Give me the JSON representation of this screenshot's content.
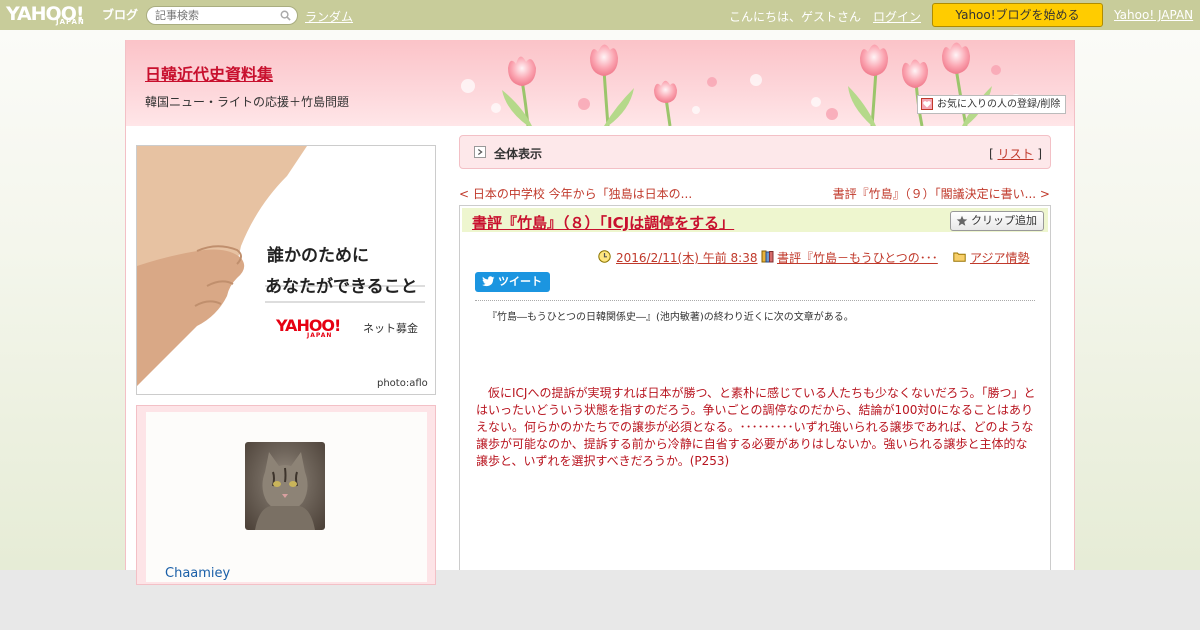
{
  "topbar": {
    "logo_yahoo": "YAHOO!",
    "logo_japan": "JAPAN",
    "logo_blog": "ブログ",
    "search_placeholder": "記事検索",
    "random_label": "ランダム",
    "greeting": "こんにちは、ゲストさん",
    "login_label": "ログイン",
    "start_button": "Yahoo!ブログを始める",
    "yahoo_japan_link": "Yahoo! JAPAN"
  },
  "header": {
    "blog_title": "日韓近代史資料集",
    "blog_subtitle": "韓国ニュー・ライトの応援＋竹島問題",
    "favorite_button": "お気に入りの人の登録/削除"
  },
  "sidebar": {
    "ad": {
      "line1": "誰かのために",
      "line2": "あなたができること",
      "logo": "YAHOO!",
      "logo_japan": "JAPAN",
      "service": "ネット募金",
      "credit": "photo:aflo"
    },
    "profile": {
      "username": "Chaamiey"
    }
  },
  "content": {
    "allview_label": "全体表示",
    "list_open": "[ ",
    "list_label": "リスト",
    "list_close": " ]",
    "prev_link": "< 日本の中学校 今年から「独島は日本の...",
    "next_link": "書評『竹島』（９）「閣議決定に書い... >",
    "article": {
      "title": "書評『竹島』（８）「ICJは調停をする」",
      "clip_button": "クリップ追加",
      "date": "2016/2/11(木) 午前 8:38",
      "theme": "書評『竹島－もうひとつの･･･",
      "category": "アジア情勢",
      "tweet_label": "ツイート",
      "intro": "『竹島―もうひとつの日韓関係史―』(池内敏著)の終わり近くに次の文章がある。",
      "quote": "　仮にICJへの提訴が実現すれば日本が勝つ、と素朴に感じている人たちも少なくないだろう。「勝つ」とはいったいどういう状態を指すのだろう。争いごとの調停なのだから、結論が100対0になることはありえない。何らかのかたちでの譲歩が必須となる。･････････いずれ強いられる譲歩であれば、どのような譲歩が可能なのか、提訴する前から冷静に自省する必要がありはしないか。強いられる譲歩と主体的な譲歩と、いずれを選択すべきだろうか。(P253)"
    }
  },
  "colors": {
    "topbar": "#c8cc9a",
    "accent": "#c8102e",
    "start_button": "#ffcc00",
    "header_pink": "#fbc3c8",
    "title_bar": "#eef6cf",
    "tweet": "#1b95e0"
  },
  "icons": [
    "search-icon",
    "favorite-icon",
    "clock-icon",
    "book-icon",
    "folder-icon",
    "star-icon",
    "twitter-bird-icon",
    "arrow-right-icon"
  ]
}
